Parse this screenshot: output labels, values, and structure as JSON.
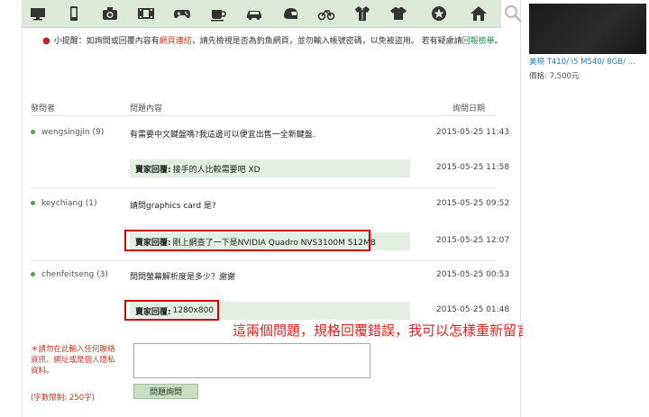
{
  "category_icons": [
    "monitor-icon",
    "phone-icon",
    "camera-icon",
    "film-icon",
    "gamepad-icon",
    "cup-icon",
    "car-icon",
    "helmet-icon",
    "bicycle-icon",
    "shirt-icon",
    "tshirt-icon",
    "star-icon",
    "home-icon"
  ],
  "tip": {
    "prefix": "小提醒：如詢問或回覆內容有",
    "link1": "網頁連結",
    "middle": "，請先檢視是否為釣魚網頁，並勿輸入帳號密碼，以免被盜用。 若有疑慮請",
    "link2": "回報檢舉",
    "suffix": "。"
  },
  "headers": {
    "asker": "發問者",
    "content": "問題內容",
    "date": "詢問日期"
  },
  "questions": [
    {
      "asker": "wengsingjin (9)",
      "text": "有需要中文鍵盤嗎?我這邊可以便宜出售一全新鍵盤.",
      "date": "2015-05-25 11:43",
      "reply": "接手的人比較需要吧 XD",
      "reply_date": "2015-05-25 11:58"
    },
    {
      "asker": "keychiang (1)",
      "text": "請問graphics card 是?",
      "date": "2015-05-25 09:52",
      "reply": "剛上網查了一下是NVIDIA Quadro NVS3100M 512MB",
      "reply_date": "2015-05-25 12:07"
    },
    {
      "asker": "chenfeitseng (3)",
      "text": "問問螢幕解析度是多少？謝謝",
      "date": "2015-05-25 00:53",
      "reply": "1280x800",
      "reply_date": "2015-05-25 01:48"
    }
  ],
  "reply_prefix": "賣家回覆:",
  "annotation": "這兩個問題，規格回覆錯誤，我可以怎樣重新留言？",
  "form": {
    "warning": "＊請勿在此輸入任何聯絡資訊、網址或是個人隱私資料。",
    "limit": "(字數限制: 250字)",
    "submit": "問題詢問"
  },
  "sidebar": {
    "title": "美規 T410/ i5 M540/ 8GB/ ...",
    "price": "價格: 7,500元"
  }
}
